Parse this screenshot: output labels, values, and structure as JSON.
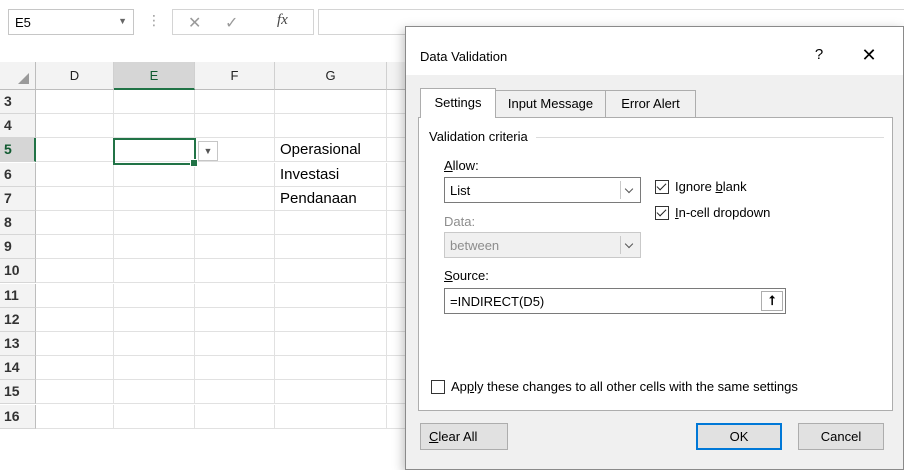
{
  "formula_bar": {
    "name_box": "E5",
    "cancel_symbol": "✕",
    "enter_symbol": "✓",
    "fx_symbol": "fx",
    "formula": ""
  },
  "sheet": {
    "columns": [
      "D",
      "E",
      "F",
      "G"
    ],
    "selected_column": "E",
    "rows": [
      "3",
      "4",
      "5",
      "6",
      "7",
      "8",
      "9",
      "10",
      "11",
      "12",
      "13",
      "14",
      "15",
      "16"
    ],
    "selected_row": "5",
    "g_values": {
      "5": "Operasional",
      "6": "Investasi",
      "7": "Pendanaan"
    },
    "accent_color": "#217346"
  },
  "dialog": {
    "title": "Data Validation",
    "help": "?",
    "close": "✕",
    "tabs": [
      "Settings",
      "Input Message",
      "Error Alert"
    ],
    "active_tab": "Settings",
    "validation_criteria_label": "Validation criteria",
    "allow": {
      "label_pre": "",
      "label_key": "A",
      "label_post": "llow:",
      "value": "List"
    },
    "ignore_blank": {
      "pre": "Ignore ",
      "key": "b",
      "post": "lank",
      "checked": true
    },
    "in_cell_dropdown": {
      "pre": "",
      "key": "I",
      "post": "n-cell dropdown",
      "checked": true
    },
    "data": {
      "label": "Data:",
      "value": "between",
      "disabled": true
    },
    "source": {
      "label_key": "S",
      "label_post": "ource:",
      "value": "=INDIRECT(D5)",
      "collapse_icon": "⭡"
    },
    "apply_all": {
      "pre": "Ap",
      "key": "p",
      "post": "ly these changes to all other cells with the same settings",
      "checked": false
    },
    "buttons": {
      "clear_all_key": "C",
      "clear_all_post": "lear All",
      "ok": "OK",
      "cancel": "Cancel"
    }
  }
}
